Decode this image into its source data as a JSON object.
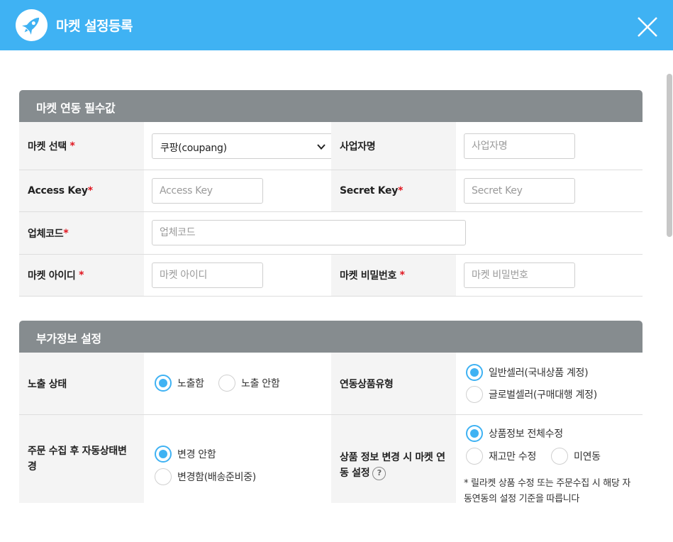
{
  "header": {
    "title": "마켓 설정등록",
    "logo_icon": "rocket-icon",
    "close_icon": "close-icon"
  },
  "section1": {
    "title": "마켓 연동 필수값",
    "market_label": "마켓 선택",
    "market_value": "쿠팡(coupang)",
    "business_label": "사업자명",
    "business_placeholder": "사업자명",
    "access_label": "Access Key",
    "access_placeholder": "Access Key",
    "secret_label": "Secret Key",
    "secret_placeholder": "Secret Key",
    "vendor_label": "업체코드",
    "vendor_placeholder": "업체코드",
    "market_id_label": "마켓 아이디",
    "market_id_placeholder": "마켓 아이디",
    "market_pw_label": "마켓 비밀번호",
    "market_pw_placeholder": "마켓 비밀번호",
    "required_mark": "*"
  },
  "section2": {
    "title": "부가정보 설정",
    "exposure_label": "노출 상태",
    "exposure_options": [
      "노출함",
      "노출 안함"
    ],
    "product_type_label": "연동상품유형",
    "product_type_options": [
      "일반셀러(국내상품 계정)",
      "글로벌셀러(구매대행 계정)"
    ],
    "order_label": "주문 수집 후 자동상태변경",
    "order_options": [
      "변경 안함",
      "변경함(배송준비중)"
    ],
    "sync_label": "상품 정보 변경 시 마켓 연동 설정",
    "help_mark": "?",
    "sync_options": [
      "상품정보 전체수정",
      "재고만 수정",
      "미연동"
    ],
    "sync_note": "* 릴라켓 상품 수정 또는 주문수집 시 해당 자동연동의 설정 기준을 따릅니다"
  },
  "colors": {
    "accent": "#3fb2f3",
    "section_header": "#868c8f",
    "required": "#e0141e"
  }
}
